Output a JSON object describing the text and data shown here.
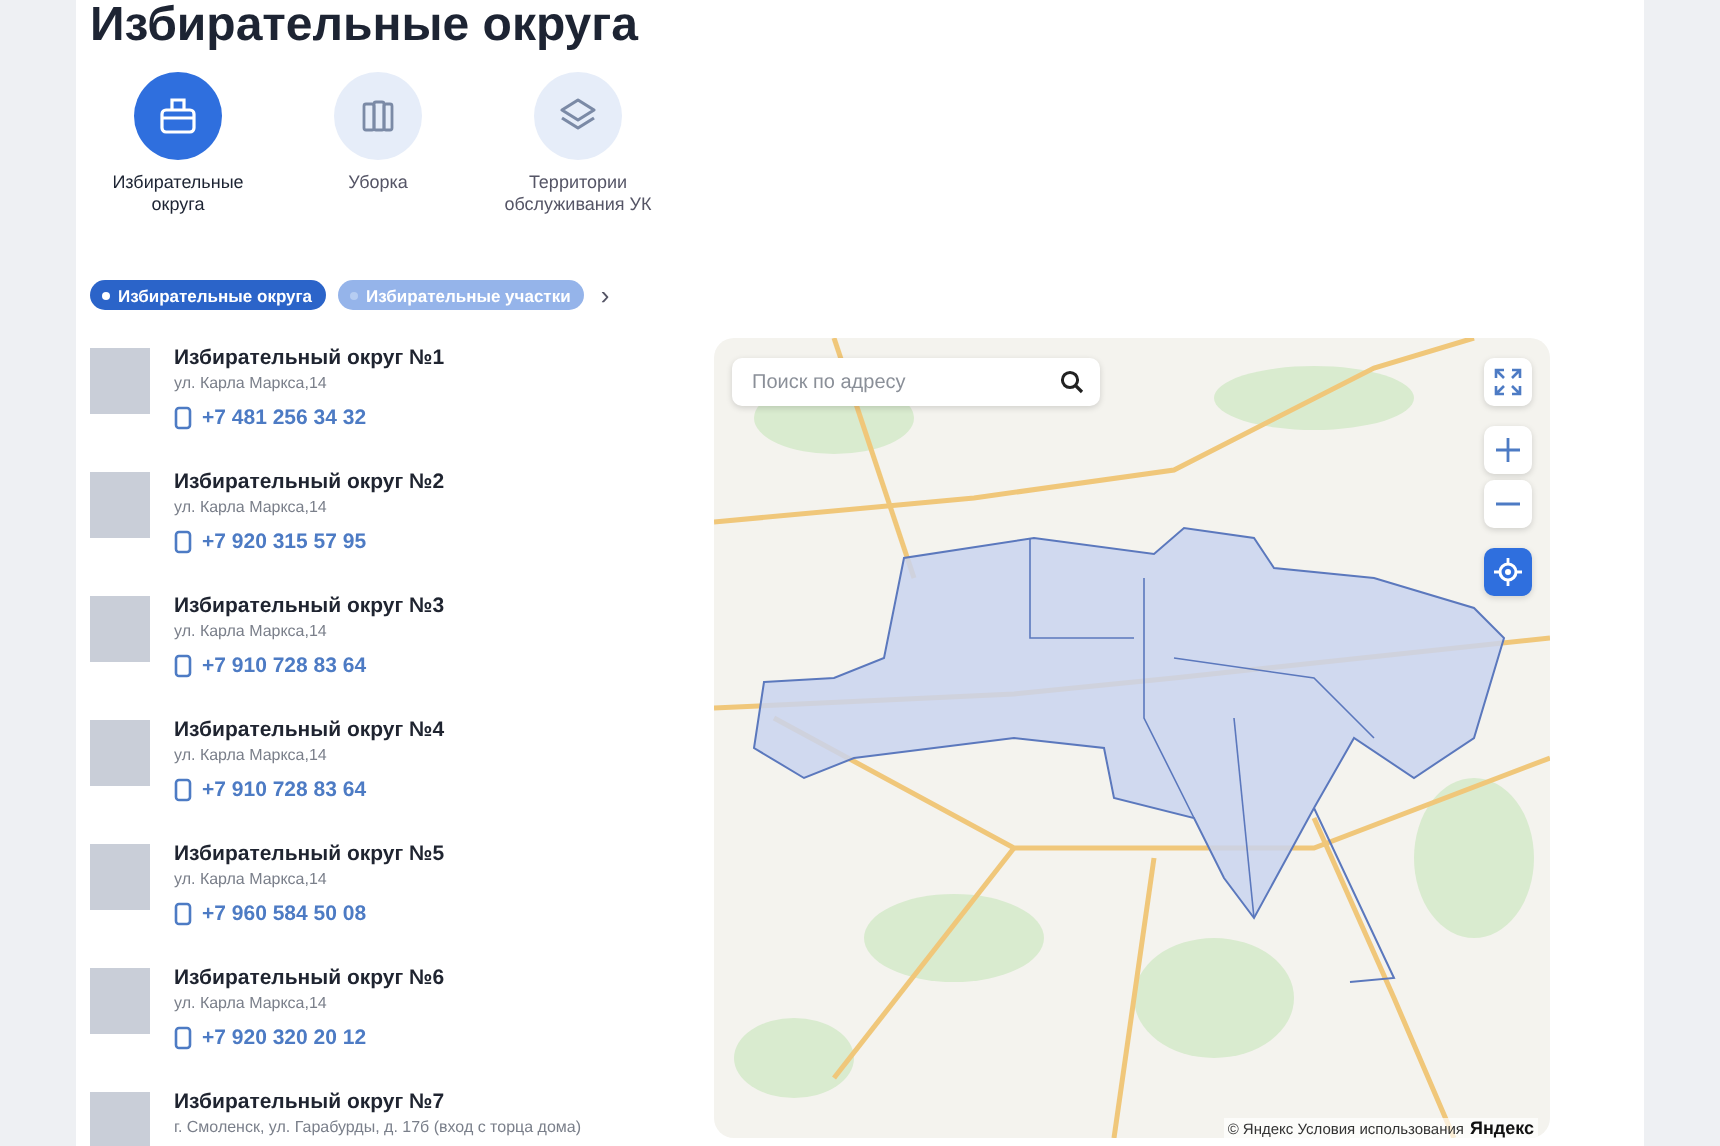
{
  "page_title": "Избирательные округа",
  "categories": [
    {
      "label": "Избирательные округа",
      "kind": "ballot",
      "selected": true
    },
    {
      "label": "Уборка",
      "kind": "bins",
      "selected": false
    },
    {
      "label": "Территории обслуживания УК",
      "kind": "layers",
      "selected": false
    }
  ],
  "filters": [
    {
      "label": "Избирательные округа",
      "selected": true
    },
    {
      "label": "Избирательные участки",
      "selected": false
    }
  ],
  "filters_more": "›",
  "districts": [
    {
      "name": "Избирательный округ №1",
      "address": "ул. Карла Маркса,14",
      "phone": "+7 481 256 34 32"
    },
    {
      "name": "Избирательный округ №2",
      "address": "ул. Карла Маркса,14",
      "phone": "+7 920 315 57 95"
    },
    {
      "name": "Избирательный округ №3",
      "address": "ул. Карла Маркса,14",
      "phone": "+7 910 728 83 64"
    },
    {
      "name": "Избирательный округ №4",
      "address": "ул. Карла Маркса,14",
      "phone": "+7 910 728 83 64"
    },
    {
      "name": "Избирательный округ №5",
      "address": "ул. Карла Маркса,14",
      "phone": "+7 960 584 50 08"
    },
    {
      "name": "Избирательный округ №6",
      "address": "ул. Карла Маркса,14",
      "phone": "+7 920 320 20 12"
    },
    {
      "name": "Избирательный округ №7",
      "address": "г. Смоленск, ул. Гарабурды, д. 17б (вход с торца дома)"
    }
  ],
  "map": {
    "search": {
      "placeholder": "Поиск по адресу"
    },
    "attribution": "© Яндекс Условия использования",
    "logo": "Яндекс"
  }
}
